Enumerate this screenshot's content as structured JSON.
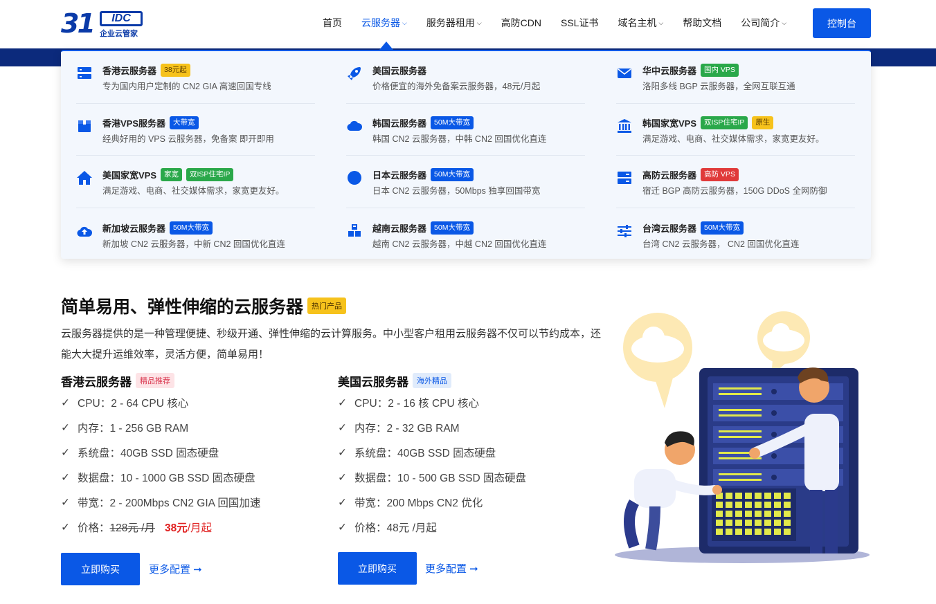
{
  "logo": {
    "num": "31",
    "idc": "IDC",
    "tag": "企业云管家"
  },
  "nav": {
    "items": [
      {
        "label": "首页",
        "chev": ""
      },
      {
        "label": "云服务器",
        "chev": "⌵"
      },
      {
        "label": "服务器租用",
        "chev": "⌵"
      },
      {
        "label": "高防CDN",
        "chev": ""
      },
      {
        "label": "SSL证书",
        "chev": ""
      },
      {
        "label": "域名主机",
        "chev": "⌵"
      },
      {
        "label": "帮助文档",
        "chev": ""
      },
      {
        "label": "公司简介",
        "chev": "⌵"
      }
    ],
    "console": "控制台"
  },
  "dropdown": {
    "items": [
      {
        "title": "香港云服务器",
        "badges": [
          {
            "text": "38元起",
            "color": "orange"
          }
        ],
        "desc": "专为国内用户定制的 CN2 GIA 高速回国专线",
        "icon": "server-icon"
      },
      {
        "title": "美国云服务器",
        "badges": [],
        "desc": "价格便宜的海外免备案云服务器，48元/月起",
        "icon": "rocket-icon"
      },
      {
        "title": "华中云服务器",
        "badges": [
          {
            "text": "国内 VPS",
            "color": "green"
          }
        ],
        "desc": "洛阳多线 BGP 云服务器，全网互联互通",
        "icon": "mail-icon"
      },
      {
        "title": "香港VPS服务器",
        "badges": [
          {
            "text": "大带宽",
            "color": "blue"
          }
        ],
        "desc": "经典好用的 VPS 云服务器，免备案 即开即用",
        "icon": "box-icon"
      },
      {
        "title": "韩国云服务器",
        "badges": [
          {
            "text": "50M大带宽",
            "color": "blue"
          }
        ],
        "desc": "韩国 CN2 云服务器，中韩 CN2 回国优化直连",
        "icon": "cloud-icon"
      },
      {
        "title": "韩国家宽VPS",
        "badges": [
          {
            "text": "双ISP住宅IP",
            "color": "green"
          },
          {
            "text": "原生",
            "color": "orange"
          }
        ],
        "desc": "满足游戏、电商、社交媒体需求，家宽更友好。",
        "icon": "bank-icon"
      },
      {
        "title": "美国家宽VPS",
        "badges": [
          {
            "text": "家宽",
            "color": "green"
          },
          {
            "text": "双ISP住宅IP",
            "color": "green"
          }
        ],
        "desc": "满足游戏、电商、社交媒体需求，家宽更友好。",
        "icon": "home-icon"
      },
      {
        "title": "日本云服务器",
        "badges": [
          {
            "text": "50M大带宽",
            "color": "blue"
          }
        ],
        "desc": "日本 CN2 云服务器，50Mbps 独享回国带宽",
        "icon": "circle-icon"
      },
      {
        "title": "高防云服务器",
        "badges": [
          {
            "text": "高防 VPS",
            "color": "red"
          }
        ],
        "desc": "宿迁 BGP 高防云服务器，150G DDoS 全网防御",
        "icon": "hdd-icon"
      },
      {
        "title": "新加坡云服务器",
        "badges": [
          {
            "text": "50M大带宽",
            "color": "blue"
          }
        ],
        "desc": "新加坡 CN2 云服务器，中新 CN2 回国优化直连",
        "icon": "cloud-upload-icon"
      },
      {
        "title": "越南云服务器",
        "badges": [
          {
            "text": "50M大带宽",
            "color": "blue"
          }
        ],
        "desc": "越南 CN2 云服务器，中越 CN2 回国优化直连",
        "icon": "cubes-icon"
      },
      {
        "title": "台湾云服务器",
        "badges": [
          {
            "text": "50M大带宽",
            "color": "blue"
          }
        ],
        "desc": "台湾 CN2 云服务器， CN2 回国优化直连",
        "icon": "sliders-icon"
      }
    ]
  },
  "section": {
    "title": "简单易用、弹性伸缩的云服务器",
    "hot": "热门产品",
    "desc": "云服务器提供的是一种管理便捷、秒级开通、弹性伸缩的云计算服务。中小型客户租用云服务器不仅可以节约成本，还能大大提升运维效率，灵活方便，简单易用！"
  },
  "plans": [
    {
      "title": "香港云服务器",
      "tag": "精品推荐",
      "specs": [
        "CPU：2 - 64 CPU 核心",
        "内存：1 - 256 GB RAM",
        "系统盘：40GB SSD 固态硬盘",
        "数据盘：10 - 1000 GB SSD 固态硬盘",
        "带宽：2 - 200Mbps CN2 GIA 回国加速"
      ],
      "price_label": "价格：",
      "old_price": "128元 /月",
      "price": "38元",
      "price_unit": "/月起",
      "buy": "立即购买",
      "more": "更多配置 ➞"
    },
    {
      "title": "美国云服务器",
      "tag": "海外精品",
      "specs": [
        "CPU：2 - 16 核 CPU 核心",
        "内存：2 - 32 GB RAM",
        "系统盘：40GB SSD 固态硬盘",
        "数据盘：10 - 500 GB SSD 固态硬盘",
        "带宽：200 Mbps CN2 优化"
      ],
      "price_label": "价格：",
      "price_plain": "48元 /月起",
      "buy": "立即购买",
      "more": "更多配置 ➞"
    }
  ],
  "check": "✓",
  "colors": {
    "primary": "#0a58e6",
    "navy": "#0c2a7c",
    "price": "#e02020"
  }
}
